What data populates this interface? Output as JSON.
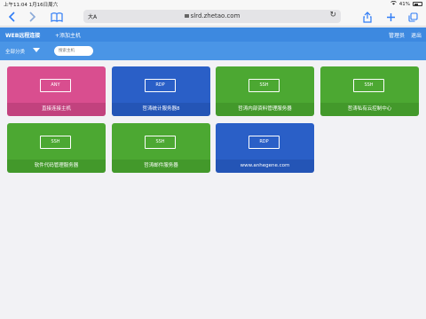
{
  "status": {
    "time": "上午11:04",
    "date": "1月16日周六",
    "battery": "41%"
  },
  "browser": {
    "text_size": "大A",
    "url": "slrd.zhetao.com"
  },
  "app": {
    "title": "WEB远程连接",
    "add_host": "+添加主机",
    "admin": "管理员",
    "logout": "退出"
  },
  "filter": {
    "group": "全部分类",
    "search_placeholder": "搜索主机"
  },
  "hosts": [
    {
      "protocol": "ANY",
      "name": "直接连接主机",
      "color": "#d94e8f"
    },
    {
      "protocol": "RDP",
      "name": "哲涛统计服务器8",
      "color": "#2a5fc7"
    },
    {
      "protocol": "SSH",
      "name": "哲涛内部资料管理服务器",
      "color": "#4ca832"
    },
    {
      "protocol": "SSH",
      "name": "哲涛私有云控制中心",
      "color": "#4ca832"
    },
    {
      "protocol": "SSH",
      "name": "软件代码管理服务器",
      "color": "#4ca832"
    },
    {
      "protocol": "SSH",
      "name": "哲涛邮件服务器",
      "color": "#4ca832"
    },
    {
      "protocol": "RDP",
      "name": "www.anhegene.com",
      "color": "#2a5fc7"
    }
  ]
}
